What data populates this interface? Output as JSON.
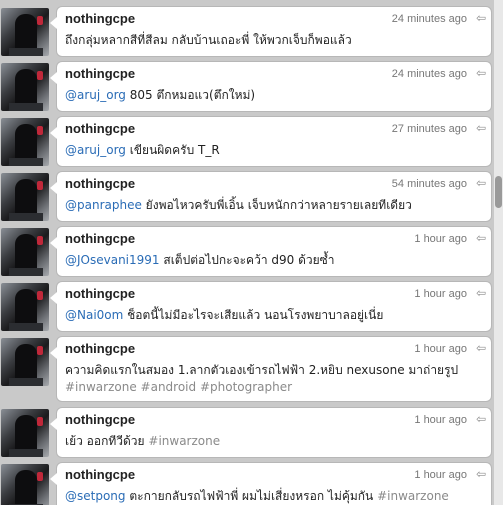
{
  "tweets": [
    {
      "user": "nothingcpe",
      "time": "24 minutes ago",
      "mention": "",
      "text": "ถึงกลุ่มหลากสีที่สีลม กลับบ้านเถอะพี่ ให้พวกเจ็บก็พอแล้ว",
      "hashtags": ""
    },
    {
      "user": "nothingcpe",
      "time": "24 minutes ago",
      "mention": "@aruj_org",
      "text": " 805 ตึกหมอแว(ตึกใหม่)",
      "hashtags": ""
    },
    {
      "user": "nothingcpe",
      "time": "27 minutes ago",
      "mention": "@aruj_org",
      "text": " เขียนผิดครับ T_R",
      "hashtags": ""
    },
    {
      "user": "nothingcpe",
      "time": "54 minutes ago",
      "mention": "@panraphee",
      "text": " ยังพอไหวครับพี่เอิ้น เจ็บหนักกว่าหลายรายเลยทีเดียว",
      "hashtags": ""
    },
    {
      "user": "nothingcpe",
      "time": "1 hour ago",
      "mention": "@JOsevani1991",
      "text": " สเต็ปต่อไปกะจะคว้า d90 ด้วยซ้ำ",
      "hashtags": ""
    },
    {
      "user": "nothingcpe",
      "time": "1 hour ago",
      "mention": "@Nai0om",
      "text": " ช็อตนี้ไม่มีอะไรจะเสียแล้ว นอนโรงพยาบาลอยู่เนี่ย",
      "hashtags": ""
    },
    {
      "user": "nothingcpe",
      "time": "1 hour ago",
      "mention": "",
      "text": "ความคิดแรกในสมอง 1.ลากตัวเองเข้ารถไฟฟ้า 2.หยิบ nexusone มาถ่ายรูป",
      "hashtags": "#inwarzone  #android #photographer"
    },
    {
      "user": "nothingcpe",
      "time": "1 hour ago",
      "mention": "",
      "text": "เย้ว ออกทีวีด้วย  ",
      "hashtags": "#inwarzone"
    },
    {
      "user": "nothingcpe",
      "time": "1 hour ago",
      "mention": "@setpong",
      "text": " ตะกายกลับรถไฟฟ้าพี่ ผมไม่เสี่ยงหรอก ไม่คุ้มกัน  ",
      "hashtags": "#inwarzone"
    }
  ],
  "icons": {
    "reply": "reply-arrow-icon"
  }
}
